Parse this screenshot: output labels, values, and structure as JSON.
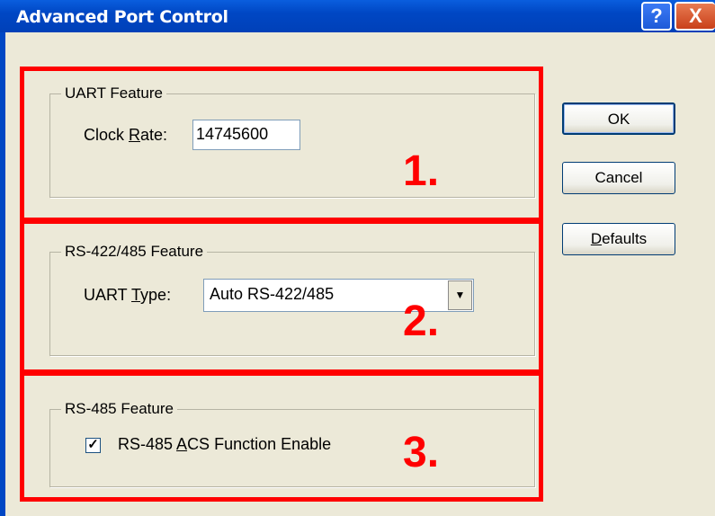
{
  "window": {
    "title": "Advanced Port Control",
    "help_glyph": "?",
    "close_glyph": "X"
  },
  "uart": {
    "legend": "UART Feature",
    "clock_label_pre": "Clock ",
    "clock_label_u": "R",
    "clock_label_post": "ate:",
    "clock_value": "14745600"
  },
  "rs422": {
    "legend": "RS-422/485 Feature",
    "type_label_pre": "UART ",
    "type_label_u": "T",
    "type_label_post": "ype:",
    "type_value": "Auto RS-422/485",
    "dropdown_glyph": "▼"
  },
  "rs485": {
    "legend": "RS-485 Feature",
    "check_glyph": "✓",
    "checked": true,
    "acs_pre": "RS-485 ",
    "acs_u": "A",
    "acs_post": "CS Function Enable"
  },
  "buttons": {
    "ok": "OK",
    "cancel": "Cancel",
    "defaults_u": "D",
    "defaults_post": "efaults"
  },
  "annotations": {
    "one": "1.",
    "two": "2.",
    "three": "3."
  },
  "colors": {
    "accent": "#ff0000",
    "title_bar": "#0047c4"
  }
}
